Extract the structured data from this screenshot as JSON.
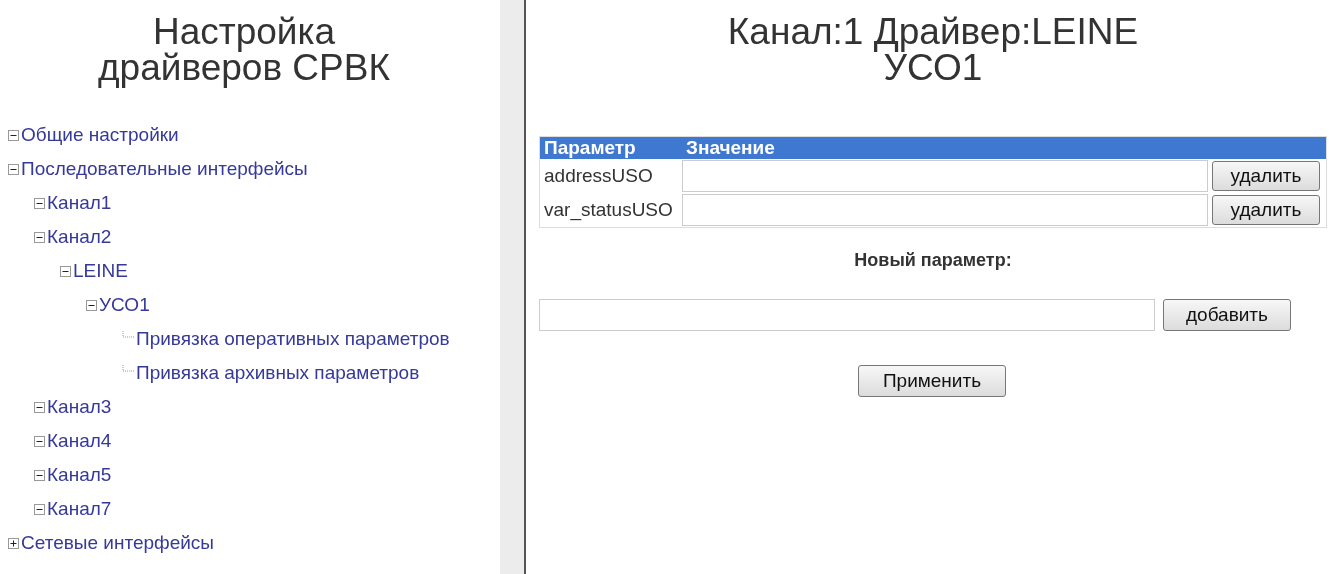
{
  "sidebar": {
    "title_lines": [
      "Настройка",
      "драйверов СРВК"
    ],
    "tree": [
      {
        "label": "Общие настройки",
        "expanded": true
      },
      {
        "label": "Последовательные интерфейсы",
        "expanded": true,
        "children": [
          {
            "label": "Канал1",
            "expanded": true
          },
          {
            "label": "Канал2",
            "expanded": true,
            "children": [
              {
                "label": "LEINE",
                "expanded": true,
                "children": [
                  {
                    "label": "УСО1",
                    "expanded": true,
                    "children": [
                      {
                        "label": "Привязка оперативных параметров"
                      },
                      {
                        "label": "Привязка архивных параметров"
                      }
                    ]
                  }
                ]
              }
            ]
          },
          {
            "label": "Канал3",
            "expanded": true
          },
          {
            "label": "Канал4",
            "expanded": true
          },
          {
            "label": "Канал5",
            "expanded": true
          },
          {
            "label": "Канал7",
            "expanded": true
          }
        ]
      },
      {
        "label": "Сетевые интерфейсы",
        "expanded": false
      }
    ]
  },
  "main": {
    "title_lines": [
      "Канал:1 Драйвер:LEINE",
      "УСО1"
    ],
    "table": {
      "columns": [
        "Параметр",
        "Значение"
      ],
      "rows": [
        {
          "name": "addressUSO",
          "action": "удалить"
        },
        {
          "name": "var_statusUSO",
          "action": "удалить"
        }
      ]
    },
    "new_parameter": {
      "label": "Новый параметр:",
      "button": "добавить"
    },
    "apply_button": "Применить"
  }
}
